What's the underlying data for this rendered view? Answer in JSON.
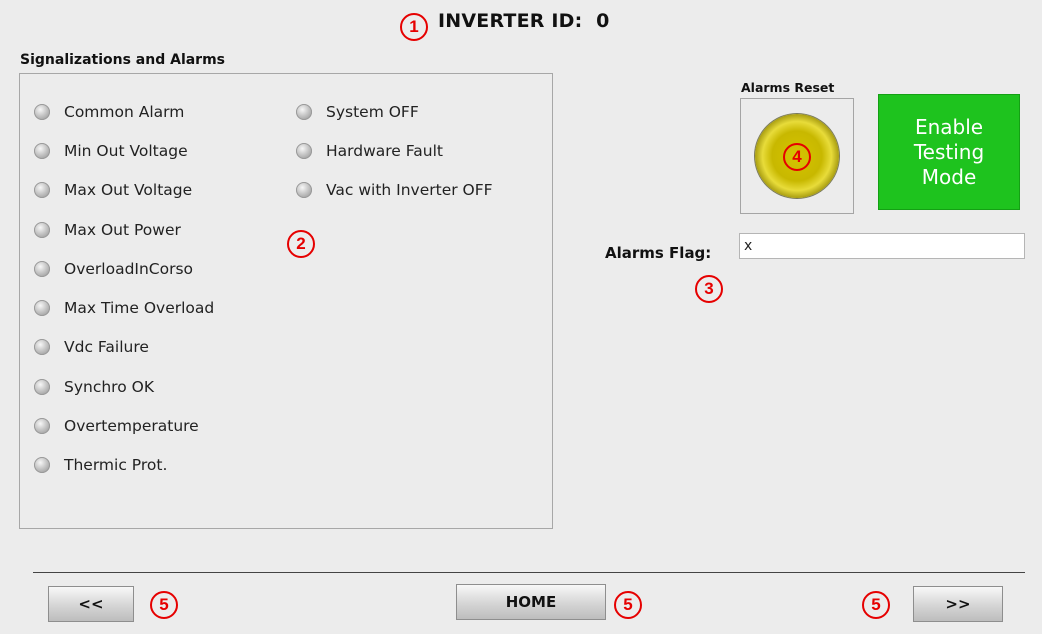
{
  "header": {
    "title": "INVERTER ID:  0"
  },
  "markers": {
    "m1": "1",
    "m2": "2",
    "m3": "3",
    "m4": "4",
    "m5a": "5",
    "m5b": "5",
    "m5c": "5"
  },
  "alarms": {
    "section_label": "Signalizations and Alarms",
    "column1": [
      "Common Alarm",
      "Min Out Voltage",
      "Max Out Voltage",
      "Max Out Power",
      "OverloadInCorso",
      "Max Time Overload",
      "Vdc Failure",
      "Synchro OK",
      "Overtemperature",
      "Thermic Prot."
    ],
    "column2": [
      "System OFF",
      "Hardware Fault",
      "Vac with Inverter OFF"
    ]
  },
  "controls": {
    "reset_label": "Alarms Reset",
    "testing_line1": "Enable",
    "testing_line2": "Testing",
    "testing_line3": "Mode",
    "flag_label": "Alarms Flag:",
    "flag_value": "x"
  },
  "nav": {
    "prev": "<<",
    "home": "HOME",
    "next": ">>"
  },
  "colors": {
    "background": "#ececec",
    "led_off": "#c4c4c4",
    "testing_button": "#1ec31e",
    "reset_button": "#c8b800",
    "marker": "#e60000"
  }
}
